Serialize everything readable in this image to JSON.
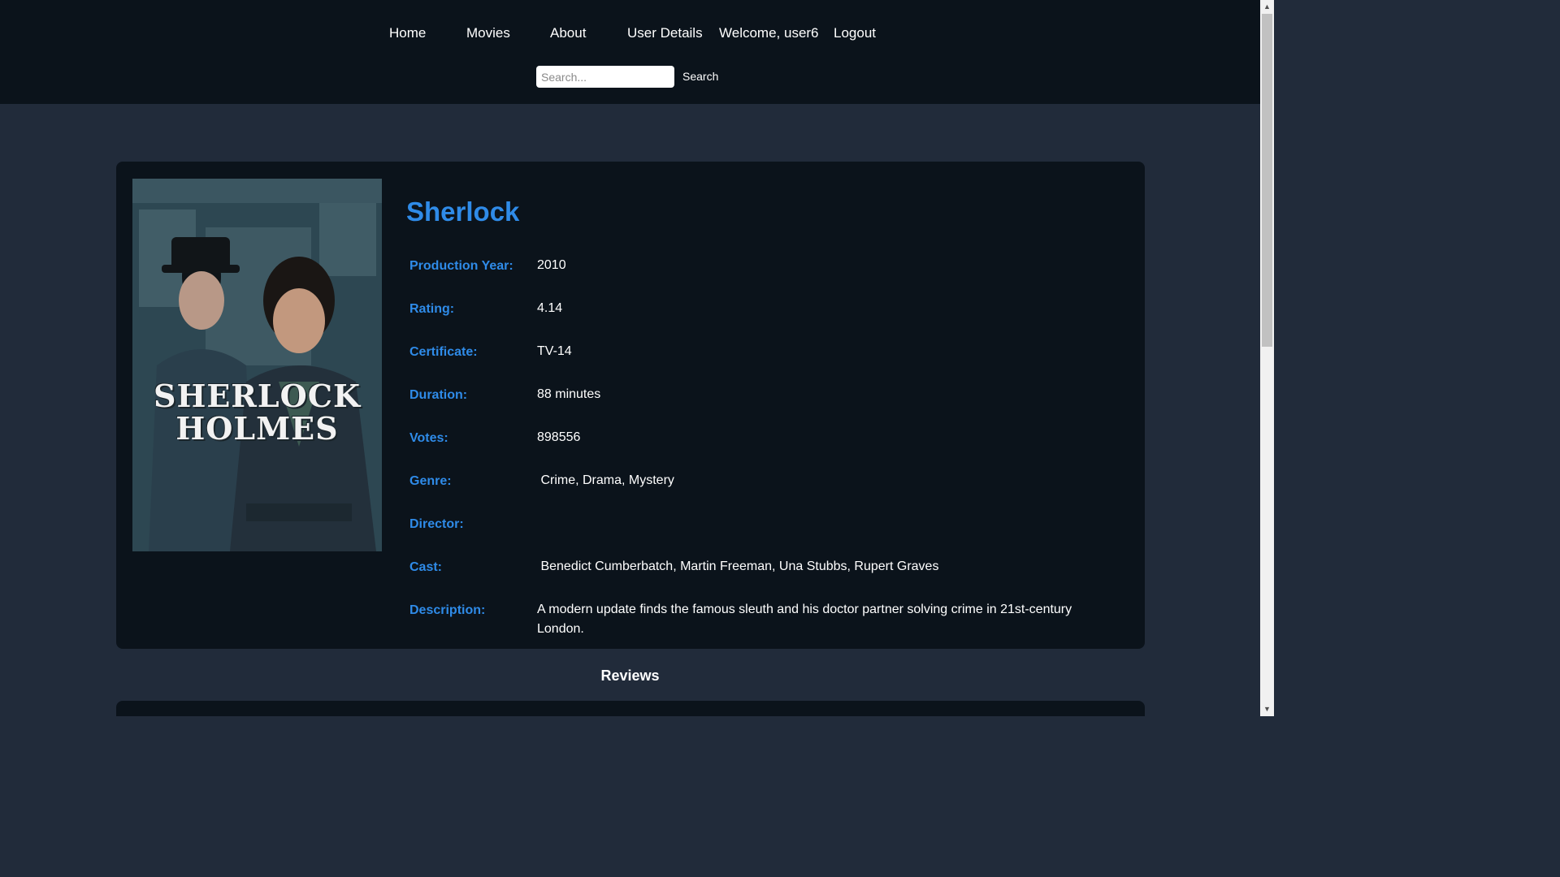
{
  "nav": {
    "home": "Home",
    "movies": "Movies",
    "about": "About",
    "user_details": "User Details",
    "welcome": "Welcome, user6",
    "logout": "Logout"
  },
  "search": {
    "placeholder": "Search...",
    "button_label": "Search"
  },
  "movie": {
    "title": "Sherlock",
    "poster_text": "SHERLOCK HOLMES",
    "details": [
      {
        "label": "Production Year:",
        "value": "2010"
      },
      {
        "label": "Rating:",
        "value": "4.14"
      },
      {
        "label": "Certificate:",
        "value": "TV-14"
      },
      {
        "label": "Duration:",
        "value": "88 minutes"
      },
      {
        "label": "Votes:",
        "value": "898556"
      },
      {
        "label": "Genre:",
        "value": " Crime, Drama, Mystery"
      },
      {
        "label": "Director:",
        "value": ""
      },
      {
        "label": "Cast:",
        "value": " Benedict Cumberbatch, Martin Freeman, Una Stubbs, Rupert Graves"
      },
      {
        "label": "Description:",
        "value": "A modern update finds the famous sleuth and his doctor partner solving crime in 21st-century London."
      }
    ]
  },
  "reviews": {
    "heading": "Reviews"
  },
  "colors": {
    "header_bg": "#0b131b",
    "page_bg": "#212b3a",
    "card_bg": "#0b131b",
    "accent": "#2f8be8",
    "text": "#ffffff"
  }
}
